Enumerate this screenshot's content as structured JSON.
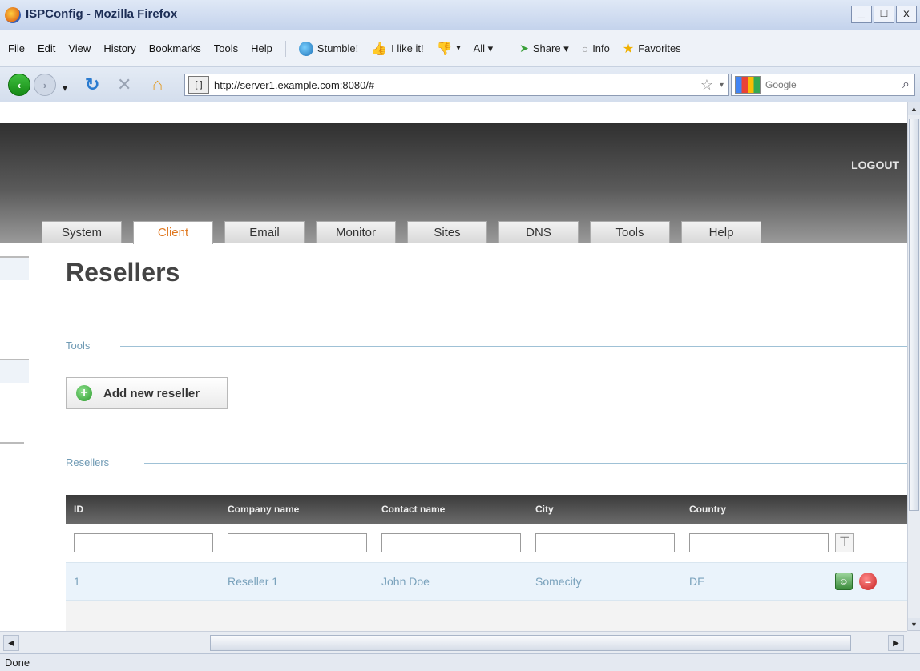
{
  "window": {
    "title": "ISPConfig - Mozilla Firefox",
    "controls": [
      "_",
      "□",
      "x"
    ]
  },
  "menubar": {
    "items": [
      "File",
      "Edit",
      "View",
      "History",
      "Bookmarks",
      "Tools",
      "Help"
    ],
    "toolbar": {
      "stumble": "Stumble!",
      "ilike": "I like it!",
      "all": "All ▾",
      "share": "Share ▾",
      "info": "Info",
      "favorites": "Favorites"
    }
  },
  "navbar": {
    "url": "http://server1.example.com:8080/#",
    "search_placeholder": "Google"
  },
  "page": {
    "logout": "LOGOUT",
    "tabs": [
      "System",
      "Client",
      "Email",
      "Monitor",
      "Sites",
      "DNS",
      "Tools",
      "Help"
    ],
    "active_tab": "Client",
    "title": "Resellers",
    "tools_label": "Tools",
    "add_button": "Add new reseller",
    "list_label": "Resellers",
    "columns": [
      "ID",
      "Company name",
      "Contact name",
      "City",
      "Country"
    ],
    "rows": [
      {
        "id": "1",
        "company": "Reseller 1",
        "contact": "John Doe",
        "city": "Somecity",
        "country": "DE"
      }
    ]
  },
  "status": "Done",
  "colors": {
    "accent_tab": "#e07820",
    "link_text": "#7aa2bc",
    "header_dark": "#303030"
  }
}
